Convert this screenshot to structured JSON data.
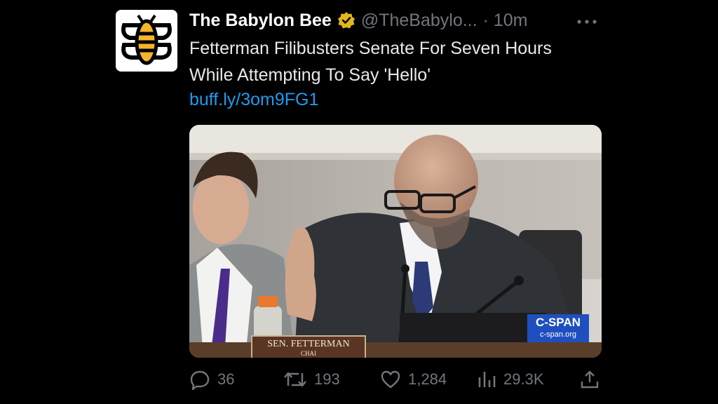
{
  "account": {
    "name": "The Babylon Bee",
    "handle": "@TheBabylo...",
    "time": "· 10m"
  },
  "tweet": {
    "text": "Fetterman Filibusters Senate For Seven Hours While Attempting To Say 'Hello'",
    "link": "buff.ly/3om9FG1"
  },
  "media": {
    "nameplate_name": "SEN. FETTERMAN",
    "nameplate_sub": "CHAI",
    "network": "C-SPAN",
    "network_url": "c-span.org"
  },
  "actions": {
    "replies": "36",
    "reposts": "193",
    "likes": "1,284",
    "views": "29.3K"
  },
  "colors": {
    "accent": "#1d9bf0",
    "muted": "#71767b",
    "verified_gold": "#e2b719",
    "logo_yellow": "#f5b52b"
  },
  "icons": [
    "more-icon",
    "verified-badge-icon",
    "reply-icon",
    "repost-icon",
    "like-icon",
    "views-icon",
    "share-icon"
  ]
}
